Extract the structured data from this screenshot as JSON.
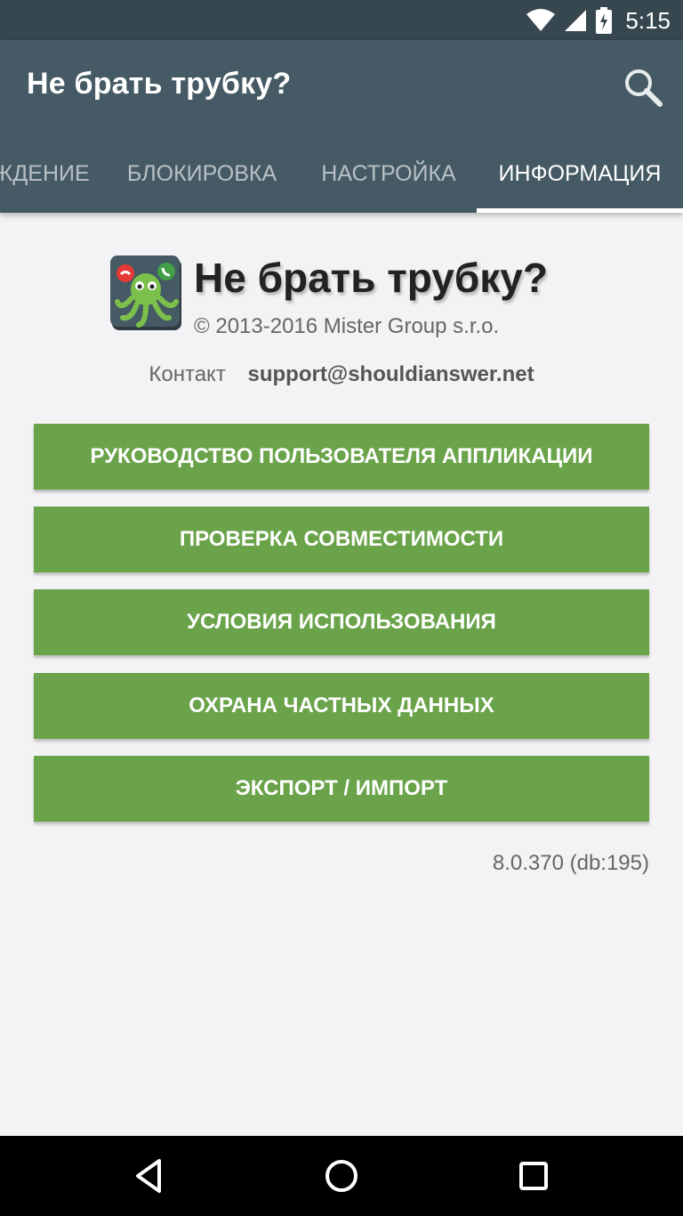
{
  "status_bar": {
    "time": "5:15",
    "icons": [
      "wifi-icon",
      "signal-icon",
      "battery-charging-icon"
    ]
  },
  "app_bar": {
    "title": "Не брать трубку?",
    "search_icon": "search-icon"
  },
  "tabs": [
    {
      "label": "ждение",
      "active": false
    },
    {
      "label": "Блокировка",
      "active": false
    },
    {
      "label": "Настройка",
      "active": false
    },
    {
      "label": "Информация",
      "active": true
    }
  ],
  "info": {
    "app_name": "Не брать трубку?",
    "copyright": "© 2013-2016 Mister Group s.r.o.",
    "contact_label": "Контакт",
    "contact_email": "support@shouldianswer.net",
    "logo_icon": "octopus-logo-icon"
  },
  "buttons": [
    {
      "label": "Руководство пользователя аппликации"
    },
    {
      "label": "Проверка совместимости"
    },
    {
      "label": "Условия использования"
    },
    {
      "label": "Охрана частных данных"
    },
    {
      "label": "Экспорт / Импорт"
    }
  ],
  "version": "8.0.370 (db:195)",
  "nav_bar": {
    "icons": [
      "back-icon",
      "home-icon",
      "recents-icon"
    ]
  },
  "colors": {
    "status_bar": "#37474f",
    "app_bar": "#455a64",
    "button_green": "#6aa34a",
    "background": "#f3f3f5"
  }
}
